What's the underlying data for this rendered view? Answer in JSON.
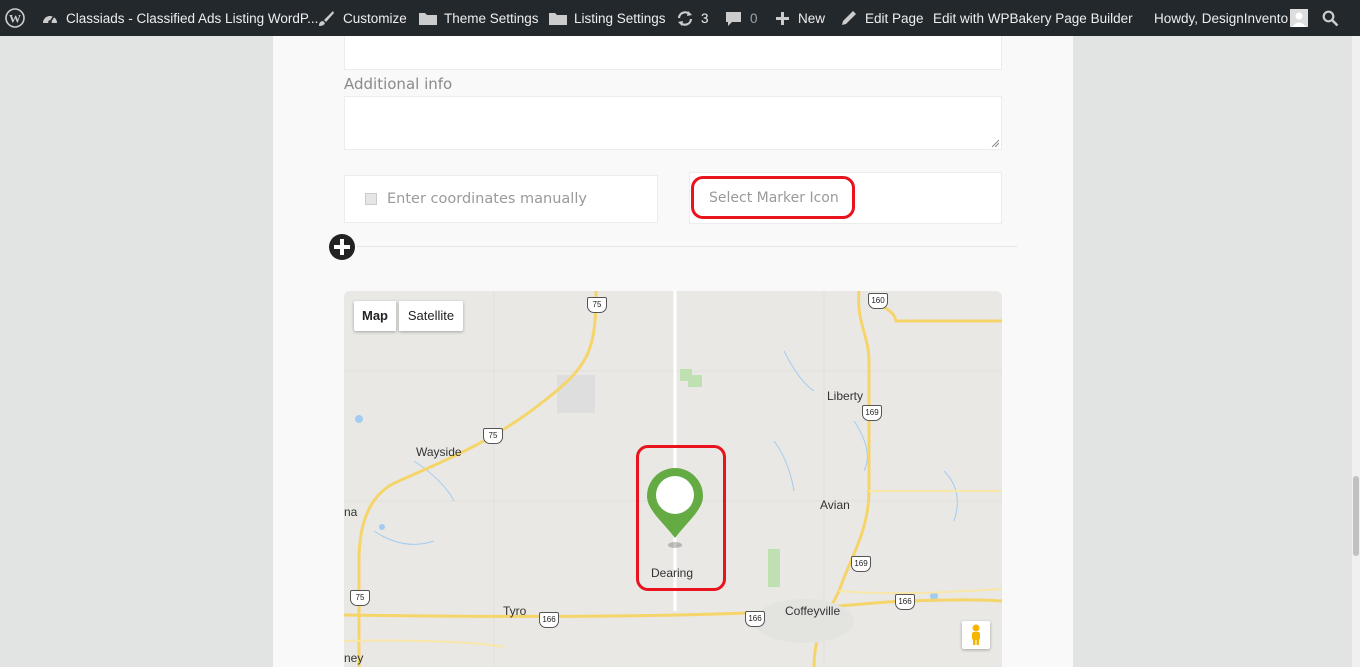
{
  "adminbar": {
    "site_title": "Classiads - Classified Ads Listing WordP...",
    "customize": "Customize",
    "theme_settings": "Theme Settings",
    "listing_settings": "Listing Settings",
    "updates_count": "3",
    "comments_count": "0",
    "new": "New",
    "edit_page": "Edit Page",
    "wpbakery": "Edit with WPBakery Page Builder",
    "howdy": "Howdy, DesignInvento"
  },
  "form": {
    "additional_info_label": "Additional info",
    "coordinates_label": "Enter coordinates manually",
    "marker_icon_label": "Select Marker Icon"
  },
  "map": {
    "tab_map": "Map",
    "tab_satellite": "Satellite",
    "places": {
      "liberty": "Liberty",
      "wayside": "Wayside",
      "avian": "Avian",
      "dearing": "Dearing",
      "tyro": "Tyro",
      "coffeyville": "Coffeyville",
      "edge_left_a": "na",
      "edge_left_b": "ney"
    },
    "routes": {
      "r75_top": "75",
      "r160": "160",
      "r169_a": "169",
      "r75_mid": "75",
      "r169_b": "169",
      "r166_right": "166",
      "r75_bottom": "75",
      "r166_left": "166",
      "r166_mid": "166"
    },
    "marker_color": "#64ab44"
  },
  "colors": {
    "highlight": "#e8131d",
    "adminbar_bg": "#23282d"
  }
}
